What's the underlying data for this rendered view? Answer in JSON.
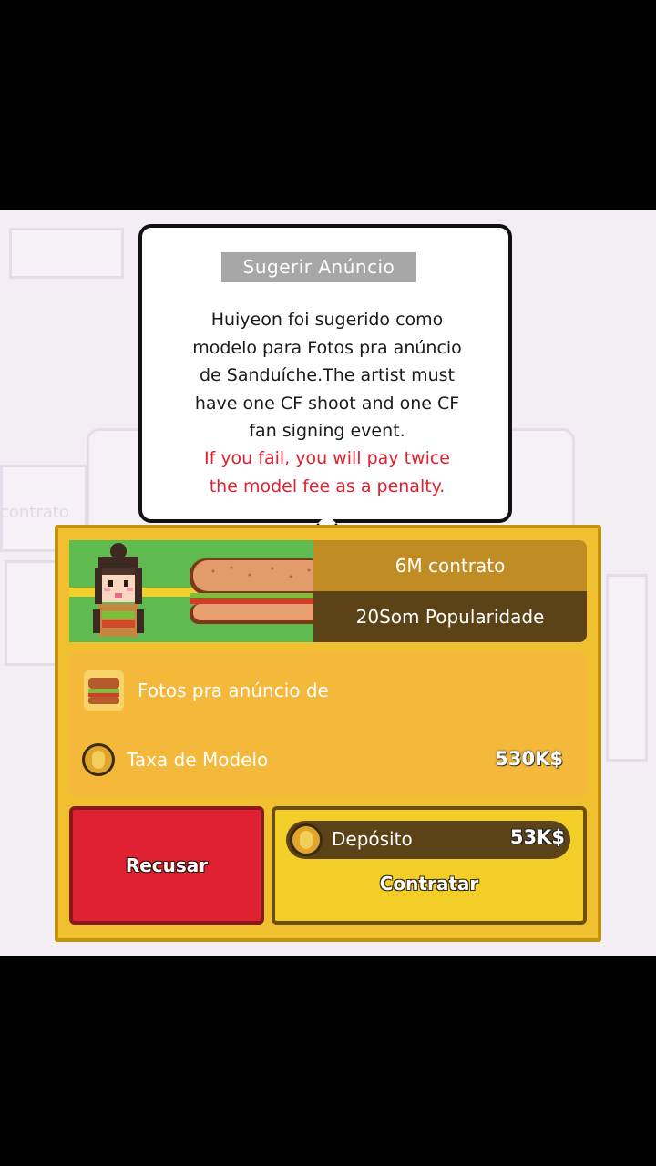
{
  "background": {
    "faded_label": "contrato"
  },
  "bubble": {
    "title": "Sugerir Anúncio",
    "body_lines": [
      "Huiyeon foi sugerido como",
      "modelo para Fotos pra anúncio",
      "de Sanduíche.The artist must",
      "have one CF shoot and one CF",
      "fan signing event."
    ],
    "warning_lines": [
      "If you fail, you will pay twice",
      "the model fee as a penalty."
    ]
  },
  "offer": {
    "contract": "6M contrato",
    "popularity": "20Som Popularidade",
    "ad_title": "Fotos pra anúncio de",
    "fee_label": "Taxa de Modelo",
    "fee_value": "530K$",
    "deposit_label": "Depósito",
    "deposit_value": "53K$"
  },
  "buttons": {
    "refuse": "Recusar",
    "hire": "Contratar"
  },
  "colors": {
    "panel": "#f0c030",
    "refuse": "#e02132",
    "hire": "#f4ce28",
    "warning_text": "#e0202e"
  },
  "icons": [
    "sandwich-icon",
    "coin-icon",
    "character-avatar"
  ]
}
